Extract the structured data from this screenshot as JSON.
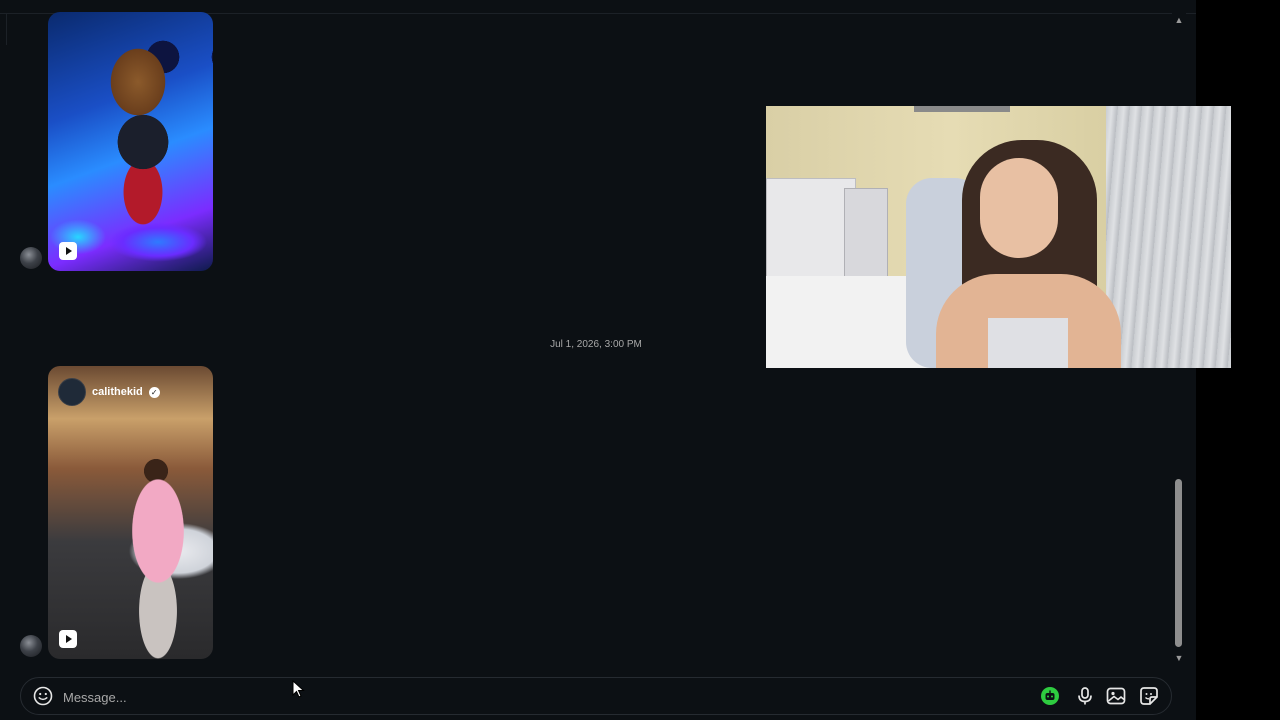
{
  "chat": {
    "timestamp": "Jul 1, 2026, 3:00 PM",
    "messages": [
      {
        "type": "reel",
        "sender_avatar": "avatar-icon",
        "has_play_icon": true
      },
      {
        "type": "reel",
        "sender_avatar": "avatar-icon",
        "username": "calithekid",
        "verified": true,
        "has_play_icon": true
      }
    ]
  },
  "composer": {
    "placeholder": "Message...",
    "icons": [
      "emoji-icon",
      "ai-icon",
      "microphone-icon",
      "image-icon",
      "sticker-icon"
    ]
  },
  "colors": {
    "background": "#0c1014",
    "border": "#262b31",
    "text_muted": "#a8a8a8",
    "ai_green": "#2ecc40"
  }
}
